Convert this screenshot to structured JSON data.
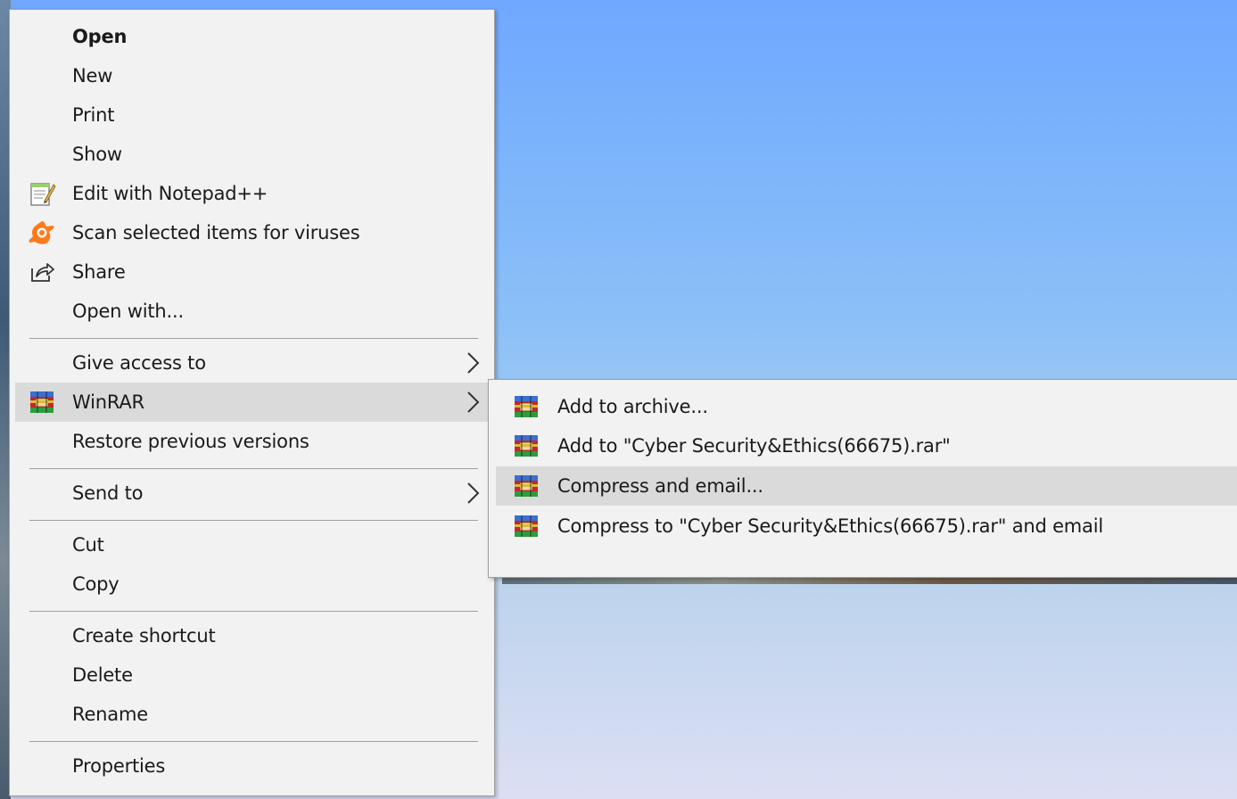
{
  "context_menu": {
    "items": [
      {
        "label": "Open"
      },
      {
        "label": "New"
      },
      {
        "label": "Print"
      },
      {
        "label": "Show"
      },
      {
        "label": "Edit with Notepad++",
        "icon": "notepad-plus-plus-icon"
      },
      {
        "label": "Scan selected items for viruses",
        "icon": "avast-icon"
      },
      {
        "label": "Share",
        "icon": "share-icon"
      },
      {
        "label": "Open with..."
      },
      {
        "label": "Give access to",
        "has_submenu": true
      },
      {
        "label": "WinRAR",
        "icon": "winrar-icon",
        "has_submenu": true,
        "highlighted": true
      },
      {
        "label": "Restore previous versions"
      },
      {
        "label": "Send to",
        "has_submenu": true
      },
      {
        "label": "Cut"
      },
      {
        "label": "Copy"
      },
      {
        "label": "Create shortcut"
      },
      {
        "label": "Delete"
      },
      {
        "label": "Rename"
      },
      {
        "label": "Properties"
      }
    ]
  },
  "winrar_submenu": {
    "items": [
      {
        "label": "Add to archive...",
        "icon": "winrar-icon"
      },
      {
        "label": "Add to \"Cyber Security&Ethics(66675).rar\"",
        "icon": "winrar-icon"
      },
      {
        "label": "Compress and email...",
        "icon": "winrar-icon",
        "highlighted": true
      },
      {
        "label": "Compress to \"Cyber Security&Ethics(66675).rar\" and email",
        "icon": "winrar-icon"
      }
    ]
  },
  "colors": {
    "menu_background": "#f2f2f2",
    "highlight": "#dadada",
    "separator": "#a0a0a0",
    "text": "#1a1a1a"
  }
}
